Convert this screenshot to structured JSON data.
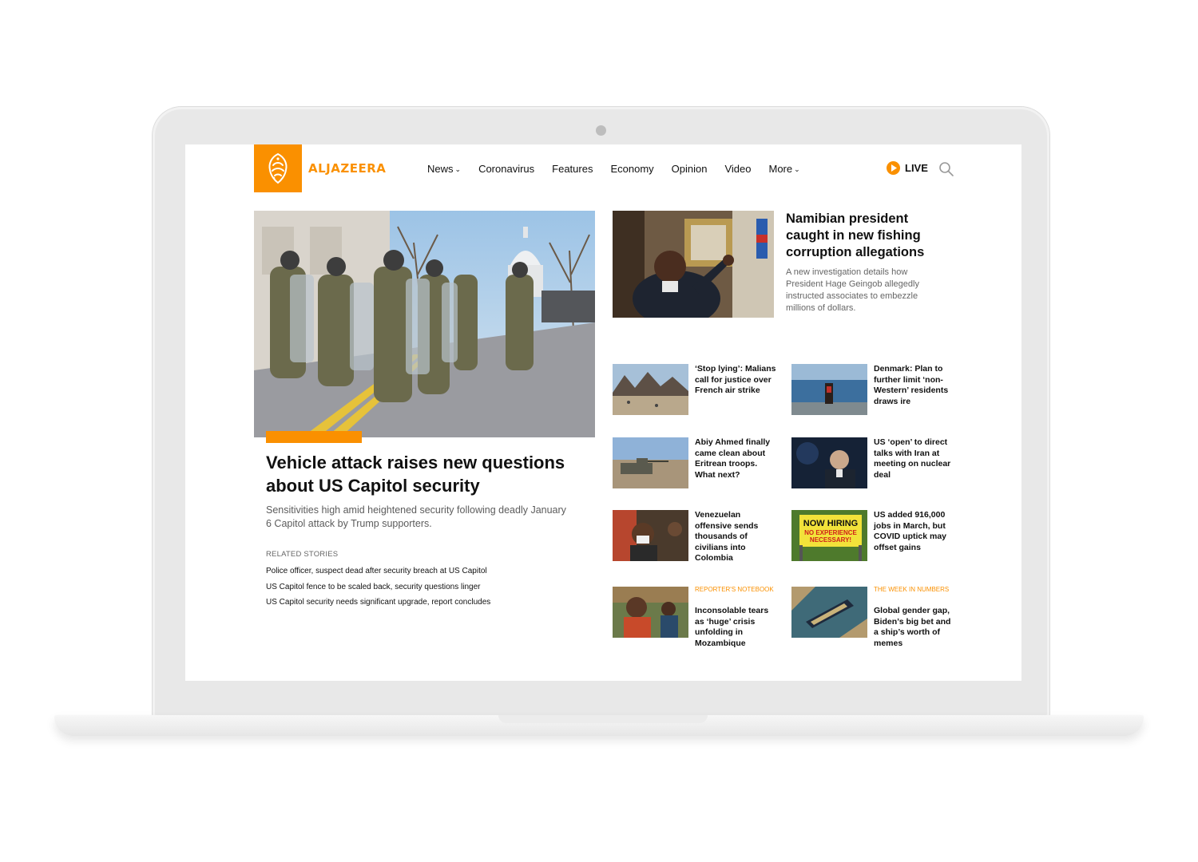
{
  "brand": {
    "name": "ALJAZEERA",
    "accent": "#fa9000"
  },
  "nav": {
    "items": [
      {
        "label": "News",
        "dropdown": true
      },
      {
        "label": "Coronavirus",
        "dropdown": false
      },
      {
        "label": "Features",
        "dropdown": false
      },
      {
        "label": "Economy",
        "dropdown": false
      },
      {
        "label": "Opinion",
        "dropdown": false
      },
      {
        "label": "Video",
        "dropdown": false
      },
      {
        "label": "More",
        "dropdown": true
      }
    ],
    "live_label": "LIVE",
    "icons": {
      "live": "play-icon",
      "search": "search-icon",
      "dropdown": "chevron-down-icon"
    }
  },
  "main_story": {
    "title": "Vehicle attack raises new questions about US Capitol security",
    "summary": "Sensitivities high amid heightened security following deadly January 6 Capitol attack by Trump supporters.",
    "related_label": "RELATED STORIES",
    "related": [
      "Police officer, suspect dead after security breach at US Capitol",
      "US Capitol fence to be scaled back, security questions linger",
      "US Capitol security needs significant upgrade, report concludes"
    ]
  },
  "featured": {
    "title": "Namibian president caught in new fishing corruption allegations",
    "summary": "A new investigation details how President Hage Geingob allegedly instructed associates to embezzle millions of dollars."
  },
  "stories": [
    {
      "category": "",
      "title": "‘Stop lying’: Malians call for justice over French air strike"
    },
    {
      "category": "",
      "title": "Denmark: Plan to further limit ‘non-Western’ residents draws ire"
    },
    {
      "category": "",
      "title": "Abiy Ahmed finally came clean about Eritrean troops. What next?"
    },
    {
      "category": "",
      "title": "US ‘open’ to direct talks with Iran at meeting on nuclear deal"
    },
    {
      "category": "",
      "title": "Venezuelan offensive sends thousands of civilians into Colombia"
    },
    {
      "category": "",
      "title": "US added 916,000 jobs in March, but COVID uptick may offset gains"
    },
    {
      "category": "REPORTER'S NOTEBOOK",
      "title": "Inconsolable tears as ‘huge’ crisis unfolding in Mozambique"
    },
    {
      "category": "THE WEEK IN NUMBERS",
      "title": "Global gender gap, Biden’s big bet and a ship’s worth of memes"
    }
  ],
  "sign_text": {
    "line1": "NOW HIRING",
    "line2": "NO EXPERIENCE",
    "line3": "NECESSARY!"
  }
}
